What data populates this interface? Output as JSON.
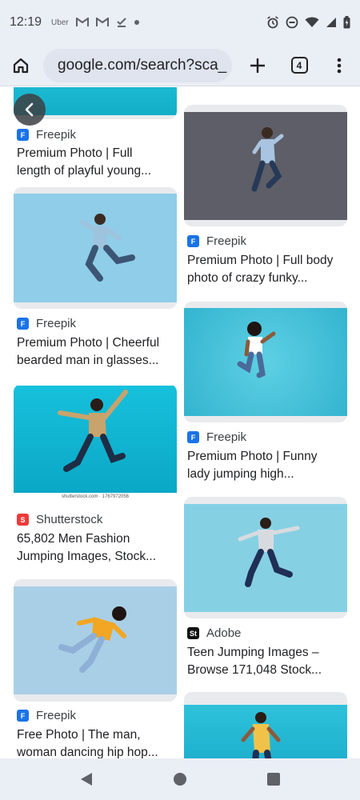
{
  "status_bar": {
    "time": "12:19",
    "app_icons": [
      "uber-icon",
      "gmail-icon",
      "gmail-icon",
      "task-check-icon",
      "dot-icon"
    ],
    "uber_label": "Uber",
    "indicators": [
      "alarm-icon",
      "do-not-disturb-icon",
      "wifi-icon",
      "cellular-signal-icon",
      "battery-icon"
    ]
  },
  "toolbar": {
    "url": "google.com/search?sca_",
    "tab_count": "4"
  },
  "results": [
    {
      "source": "Freepik",
      "title_line1": "Premium Photo | Full",
      "title_line2": "length of playful young...",
      "source_color": "#1a73e8",
      "source_glyph": "F"
    },
    {
      "source": "Freepik",
      "title_line1": "Premium Photo | Full body",
      "title_line2": "photo of crazy funky...",
      "source_color": "#1a73e8",
      "source_glyph": "F"
    },
    {
      "source": "Freepik",
      "title_line1": "Premium Photo | Cheerful",
      "title_line2": "bearded man in glasses...",
      "source_color": "#1a73e8",
      "source_glyph": "F"
    },
    {
      "source": "Freepik",
      "title_line1": "Premium Photo | Funny",
      "title_line2": "lady jumping high...",
      "source_color": "#1a73e8",
      "source_glyph": "F"
    },
    {
      "source": "Shutterstock",
      "title_line1": "65,802 Men Fashion",
      "title_line2": "Jumping Images, Stock...",
      "source_color": "#ee3a3a",
      "source_glyph": "S",
      "watermark": "shutterstock.com · 1767972056"
    },
    {
      "source": "Adobe",
      "title_line1": "Teen Jumping Images –",
      "title_line2": "Browse 171,048 Stock...",
      "source_color": "#111111",
      "source_glyph": "St"
    },
    {
      "source": "Freepik",
      "title_line1": "Free Photo | The man,",
      "title_line2": "woman dancing hip hop...",
      "source_color": "#1a73e8",
      "source_glyph": "F"
    }
  ]
}
